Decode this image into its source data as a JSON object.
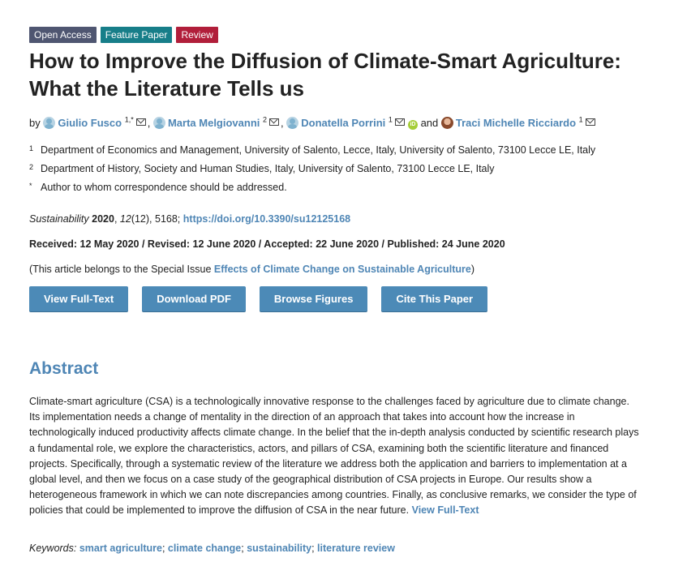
{
  "badges": {
    "open_access": "Open Access",
    "feature_paper": "Feature Paper",
    "review": "Review"
  },
  "title": "How to Improve the Diffusion of Climate-Smart Agriculture: What the Literature Tells us",
  "authors": {
    "by": "by",
    "and": "and",
    "list": [
      {
        "name": "Giulio Fusco",
        "sup": "1,*"
      },
      {
        "name": "Marta Melgiovanni",
        "sup": "2"
      },
      {
        "name": "Donatella Porrini",
        "sup": "1"
      },
      {
        "name": "Traci Michelle Ricciardo",
        "sup": "1"
      }
    ],
    "orcid_label": "iD"
  },
  "affiliations": [
    {
      "num": "1",
      "text": "Department of Economics and Management, University of Salento, Lecce, Italy, University of Salento, 73100 Lecce LE, Italy"
    },
    {
      "num": "2",
      "text": "Department of History, Society and Human Studies, Italy, University of Salento, 73100 Lecce LE, Italy"
    },
    {
      "num": "*",
      "text": "Author to whom correspondence should be addressed."
    }
  ],
  "citation": {
    "journal": "Sustainability",
    "year": "2020",
    "volume": "12",
    "rest": "(12), 5168;",
    "doi": "https://doi.org/10.3390/su12125168"
  },
  "dates": "Received: 12 May 2020 / Revised: 12 June 2020 / Accepted: 22 June 2020 / Published: 24 June 2020",
  "special_issue": {
    "prefix": "(This article belongs to the Special Issue ",
    "link": "Effects of Climate Change on Sustainable Agriculture",
    "suffix": ")"
  },
  "buttons": {
    "full_text": "View Full-Text",
    "download_pdf": "Download PDF",
    "browse_figures": "Browse Figures",
    "cite": "Cite This Paper"
  },
  "abstract": {
    "heading": "Abstract",
    "text": "Climate-smart agriculture (CSA) is a technologically innovative response to the challenges faced by agriculture due to climate change. Its implementation needs a change of mentality in the direction of an approach that takes into account how the increase in technologically induced productivity affects climate change. In the belief that the in-depth analysis conducted by scientific research plays a fundamental role, we explore the characteristics, actors, and pillars of CSA, examining both the scientific literature and financed projects. Specifically, through a systematic review of the literature we address both the application and barriers to implementation at a global level, and then we focus on a case study of the geographical distribution of CSA projects in Europe. Our results show a heterogeneous framework in which we can note discrepancies among countries. Finally, as conclusive remarks, we consider the type of policies that could be implemented to improve the diffusion of CSA in the near future.",
    "link": "View Full-Text"
  },
  "keywords": {
    "label": "Keywords:",
    "items": [
      "smart agriculture",
      "climate change",
      "sustainability",
      "literature review"
    ]
  }
}
